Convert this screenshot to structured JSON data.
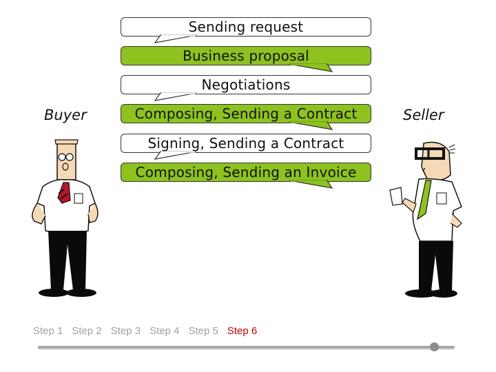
{
  "messages": [
    {
      "text": "Sending request",
      "style": "white",
      "direction": "buyer-to-seller"
    },
    {
      "text": "Business proposal",
      "style": "green",
      "direction": "seller-to-buyer"
    },
    {
      "text": "Negotiations",
      "style": "white",
      "direction": "buyer-to-seller"
    },
    {
      "text": "Composing, Sending a Contract",
      "style": "green",
      "direction": "seller-to-buyer"
    },
    {
      "text": "Signing, Sending a Contract",
      "style": "white",
      "direction": "buyer-to-seller"
    },
    {
      "text": "Composing, Sending an Invoice",
      "style": "green",
      "direction": "seller-to-buyer"
    }
  ],
  "roles": {
    "buyer": "Buyer",
    "seller": "Seller"
  },
  "steps": [
    {
      "label": "Step 1",
      "active": false
    },
    {
      "label": "Step 2",
      "active": false
    },
    {
      "label": "Step 3",
      "active": false
    },
    {
      "label": "Step 4",
      "active": false
    },
    {
      "label": "Step 5",
      "active": false
    },
    {
      "label": "Step 6",
      "active": true
    }
  ],
  "progress": {
    "value": 0.95
  },
  "colors": {
    "green_bubble": "#8dc21f",
    "active_step": "#c00000",
    "inactive_step": "#a0a0a0"
  }
}
